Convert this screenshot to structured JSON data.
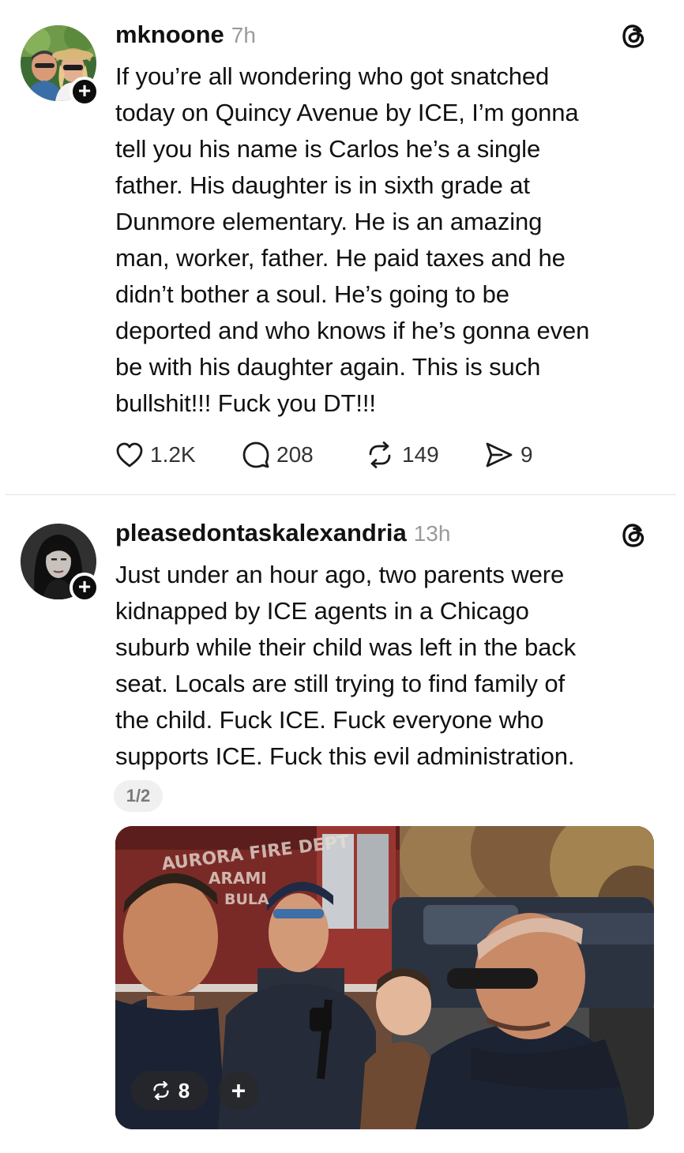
{
  "posts": [
    {
      "username": "mknoone",
      "timestamp": "7h",
      "text": "If you’re all wondering who got snatched\ntoday on Quincy Avenue by ICE, I’m gonna\ntell you his name is Carlos he’s a single\nfather. His daughter is in sixth grade at\nDunmore elementary. He is an amazing\nman, worker, father. He paid taxes and he\ndidn’t bother a soul. He’s going to  be\ndeported and who knows if he’s gonna even\nbe with his daughter again. This is such\nbullshit!!! Fuck you DT!!!",
      "likes": "1.2K",
      "replies": "208",
      "reposts": "149",
      "shares": "9"
    },
    {
      "username": "pleasedontaskalexandria",
      "timestamp": "13h",
      "text": "Just under an hour ago, two parents were\nkidnapped by ICE agents in a Chicago\nsuburb while their child was left in the back\nseat. Locals are still trying to find family of\nthe child. Fuck ICE. Fuck everyone who\nsupports ICE. Fuck this evil administration.",
      "page_indicator": "1/2",
      "media": {
        "truck_line1": "AURORA FIRE DEPT",
        "truck_line2": "ARAMI",
        "truck_line3": "BULA",
        "repost_count": "8"
      }
    }
  ],
  "icons": {
    "follow": "+",
    "threads_logo": "threads-logo-icon",
    "like": "heart-icon",
    "reply": "comment-bubble-icon",
    "repost": "repost-icon",
    "share": "send-icon"
  },
  "colors": {
    "text": "#111111",
    "muted": "#9a9a9a",
    "divider": "#e2e2e2"
  }
}
